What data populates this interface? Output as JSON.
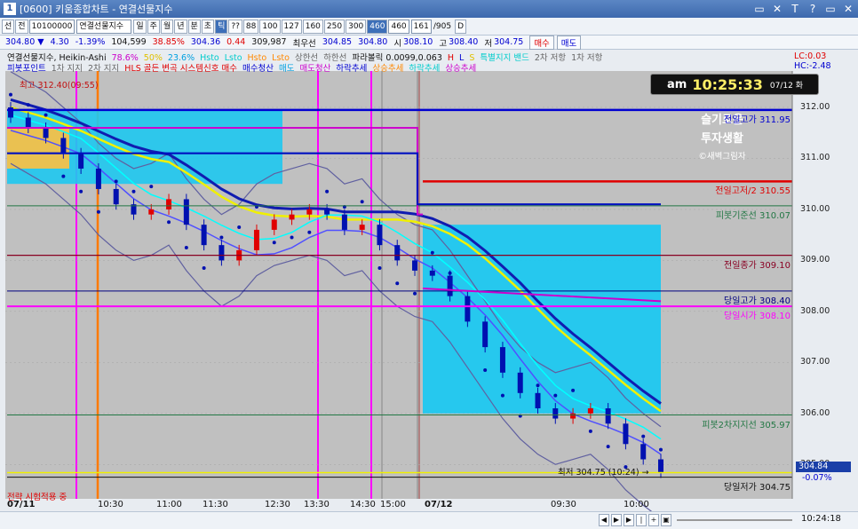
{
  "window": {
    "title": "[0600] 키움종합차트 - 연결선물지수",
    "icon": "1",
    "controls": [
      "▭",
      "✕",
      "T",
      "?",
      "▭",
      "✕"
    ]
  },
  "toolbar1": {
    "mode": "선",
    "chart": "전",
    "code": "10100000",
    "name": "연결선물지수",
    "periods": [
      "일",
      "주",
      "월",
      "년",
      "분",
      "초",
      "틱"
    ],
    "active_period": "틱",
    "intervals": [
      "??",
      "88",
      "100",
      "127",
      "160",
      "250",
      "300",
      "460"
    ],
    "active_interval": "460",
    "interval_value": "460",
    "count": "161",
    "total": "/905",
    "d_label": "D"
  },
  "quote": {
    "price": "304.80 ▼",
    "change": "4.30",
    "pct": "-1.39%",
    "volume": "104,599",
    "vol_pct": "38.85%",
    "bid": "304.36",
    "spread": "0.44",
    "contract": "309,987",
    "best_label": "최우선",
    "best_bid": "304.85",
    "best_ask": "304.80",
    "open_label": "시",
    "open": "308.10",
    "high_label": "고",
    "high": "308.40",
    "low_label": "저",
    "low": "304.75",
    "buy": "매수",
    "sell": "매도"
  },
  "legend": {
    "row1": [
      {
        "t": "연결선물지수, Heikin-Ashi",
        "c": "#111111"
      },
      {
        "t": "78.6%",
        "c": "#cc00cc"
      },
      {
        "t": "50%",
        "c": "#e0c000"
      },
      {
        "t": "23.6%",
        "c": "#00a0e0"
      },
      {
        "t": "Hsto",
        "c": "#00cccc"
      },
      {
        "t": "Lsto",
        "c": "#00cccc"
      },
      {
        "t": "Hsto",
        "c": "#ff8800"
      },
      {
        "t": "Lsto",
        "c": "#ff8800"
      },
      {
        "t": "상한선",
        "c": "#666666"
      },
      {
        "t": "하한선",
        "c": "#666666"
      },
      {
        "t": "파라볼릭 0.0099,0.063",
        "c": "#111111"
      },
      {
        "t": "H",
        "c": "#e00000"
      },
      {
        "t": "L",
        "c": "#0000d0"
      },
      {
        "t": "S",
        "c": "#e0c000"
      },
      {
        "t": "특별지지 밴드",
        "c": "#00cccc"
      },
      {
        "t": "2차 저항",
        "c": "#666666"
      },
      {
        "t": "1차 저항",
        "c": "#666666"
      }
    ],
    "row2": [
      {
        "t": "피봇포인트",
        "c": "#0000d0"
      },
      {
        "t": "1차 지지",
        "c": "#666666"
      },
      {
        "t": "2차 지지",
        "c": "#666666"
      },
      {
        "t": "HLS 골든 변곡 시스템신호 매수",
        "c": "#e00000"
      },
      {
        "t": "매수청산",
        "c": "#0000d0"
      },
      {
        "t": "매도",
        "c": "#00a0e0"
      },
      {
        "t": "매도청산",
        "c": "#cc00cc"
      },
      {
        "t": "하락추세",
        "c": "#0000d0"
      },
      {
        "t": "상승추세",
        "c": "#ff8800"
      },
      {
        "t": "하락추세",
        "c": "#00cccc"
      },
      {
        "t": "상승추세",
        "c": "#cc00cc"
      }
    ]
  },
  "lc": "LC:0.03",
  "hc": "HC:-2.48",
  "clock": {
    "ampm": "am",
    "time": "10:25:33",
    "date": "07/12 화"
  },
  "badge": {
    "line1": "슬기로운",
    "line2": "투자생활",
    "line3": "©새벽그림자"
  },
  "levels": {
    "prevhigh": {
      "label": "전일고가 311.95",
      "color": "#0000d0"
    },
    "prevmid": {
      "label": "전일고저/2 310.55",
      "color": "#e00000"
    },
    "pivot": {
      "label": "피봇기준선 310.07",
      "color": "#227744"
    },
    "prevclose": {
      "label": "전일종가 309.10",
      "color": "#880022"
    },
    "dayhigh": {
      "label": "당일고가 308.40",
      "color": "#000080"
    },
    "dayopen": {
      "label": "당일시가 308.10",
      "color": "#ff00ff"
    },
    "pivot2": {
      "label": "피봇2차지지선 305.97",
      "color": "#227744"
    },
    "daylow": {
      "label": "당일저가 304.75",
      "color": "#111111"
    }
  },
  "price_ticks": [
    "312.00",
    "311.00",
    "310.00",
    "309.00",
    "308.00",
    "307.00",
    "306.00",
    "305.00"
  ],
  "current_price": "304.84",
  "current_pct": "-0.07%",
  "strategy_text": "전략 시험적용 중",
  "high_note": "최고 312.40(09:55)",
  "low_note": "최저 304.75 (10:24) →",
  "time_ticks": [
    "07/11",
    "10:30",
    "11:00",
    "11:30",
    "12:30",
    "13:30",
    "14:30",
    "15:00",
    "07/12",
    "09:30",
    "10:00"
  ],
  "bottom_time": "10:24:18",
  "chart_data": {
    "type": "line",
    "title": "연결선물지수, Heikin-Ashi",
    "ylim": [
      304.5,
      312.4
    ],
    "heikin_ashi_close": [
      311.8,
      311.6,
      311.4,
      311.1,
      310.8,
      310.4,
      310.1,
      309.9,
      310.0,
      310.2,
      309.7,
      309.3,
      309.0,
      309.2,
      309.6,
      309.8,
      309.9,
      310.0,
      309.9,
      309.6,
      309.7,
      309.3,
      309.0,
      308.8,
      308.7,
      308.3,
      307.8,
      307.3,
      306.8,
      306.4,
      306.1,
      305.9,
      306.0,
      306.1,
      305.8,
      305.4,
      305.1,
      304.84
    ],
    "resistance_lines": [
      311.95,
      310.55,
      310.07,
      309.1,
      308.4,
      308.1,
      305.97,
      304.75
    ],
    "grid": true
  }
}
